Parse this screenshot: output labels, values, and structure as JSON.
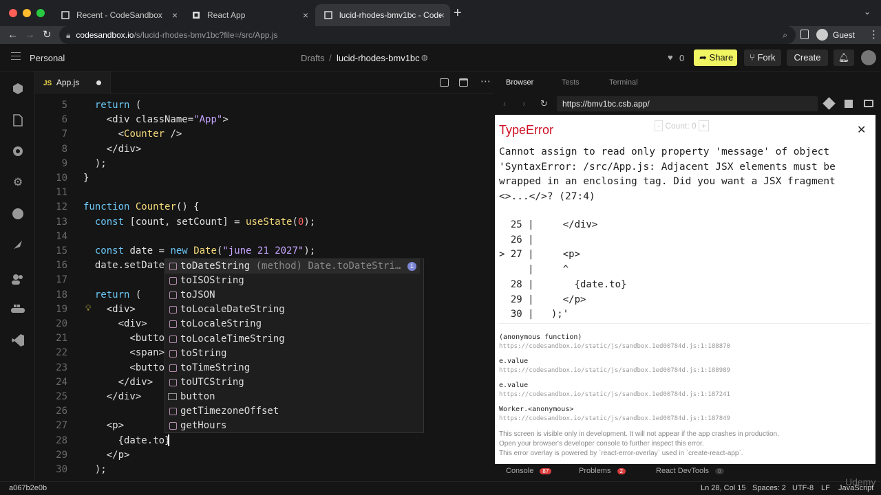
{
  "browser": {
    "tabs": [
      {
        "title": "Recent - CodeSandbox"
      },
      {
        "title": "React App"
      },
      {
        "title": "lucid-rhodes-bmv1bc - CodeS"
      }
    ],
    "url_host": "codesandbox.io",
    "url_path": "/s/lucid-rhodes-bmv1bc?file=/src/App.js",
    "profile": "Guest"
  },
  "header": {
    "workspace": "Personal",
    "breadcrumb_root": "Drafts",
    "breadcrumb_sep": "/",
    "sandbox": "lucid-rhodes-bmv1bc",
    "likes": "0",
    "share": "Share",
    "fork": "Fork",
    "create": "Create"
  },
  "editor": {
    "tab_label": "App.js",
    "tab_badge": "JS",
    "lines": [
      {
        "n": "5",
        "html": "  <span class='kw'>return</span> ("
      },
      {
        "n": "6",
        "html": "    &lt;div className=<span class='str'>\"App\"</span>&gt;"
      },
      {
        "n": "7",
        "html": "      &lt;<span class='cmp'>Counter</span> /&gt;"
      },
      {
        "n": "8",
        "html": "    &lt;/div&gt;"
      },
      {
        "n": "9",
        "html": "  );"
      },
      {
        "n": "10",
        "html": "}"
      },
      {
        "n": "11",
        "html": ""
      },
      {
        "n": "12",
        "html": "<span class='kw'>function</span> <span class='cmp'>Counter</span>() {"
      },
      {
        "n": "13",
        "html": "  <span class='kw'>const</span> [count, setCount] = <span class='cmp'>useState</span>(<span class='num'>0</span>);"
      },
      {
        "n": "14",
        "html": ""
      },
      {
        "n": "15",
        "html": "  <span class='kw'>const</span> date = <span class='kw'>new</span> <span class='cmp'>Date</span>(<span class='str'>\"june 21 2027\"</span>);"
      },
      {
        "n": "16",
        "html": "  date.setDate"
      },
      {
        "n": "17",
        "html": ""
      },
      {
        "n": "18",
        "html": "  <span class='kw'>return</span> ("
      },
      {
        "n": "19",
        "html": "    &lt;div&gt;"
      },
      {
        "n": "20",
        "html": "      &lt;div&gt;"
      },
      {
        "n": "21",
        "html": "        &lt;butto                                  button&gt;"
      },
      {
        "n": "22",
        "html": "        &lt;span&gt;"
      },
      {
        "n": "23",
        "html": "        &lt;butto                                  button&gt;"
      },
      {
        "n": "24",
        "html": "      &lt;/div&gt;"
      },
      {
        "n": "25",
        "html": "    &lt;/div&gt;"
      },
      {
        "n": "26",
        "html": ""
      },
      {
        "n": "27",
        "html": "    &lt;p&gt;"
      },
      {
        "n": "28",
        "html": "      {date.to}"
      },
      {
        "n": "29",
        "html": "    &lt;/p&gt;"
      },
      {
        "n": "30",
        "html": "  );"
      }
    ],
    "suggestions": [
      {
        "label": "toDateString",
        "detail": "(method) Date.toDateStri…",
        "kind": "method"
      },
      {
        "label": "toISOString",
        "kind": "method"
      },
      {
        "label": "toJSON",
        "kind": "method"
      },
      {
        "label": "toLocaleDateString",
        "kind": "method"
      },
      {
        "label": "toLocaleString",
        "kind": "method"
      },
      {
        "label": "toLocaleTimeString",
        "kind": "method"
      },
      {
        "label": "toString",
        "kind": "method"
      },
      {
        "label": "toTimeString",
        "kind": "method"
      },
      {
        "label": "toUTCString",
        "kind": "method"
      },
      {
        "label": "button",
        "kind": "word"
      },
      {
        "label": "getTimezoneOffset",
        "kind": "method"
      },
      {
        "label": "getHours",
        "kind": "method"
      }
    ]
  },
  "preview": {
    "tabs": [
      "Browser",
      "Tests",
      "Terminal"
    ],
    "url": "https://bmv1bc.csb.app/",
    "counter_text": "Count: 0",
    "error_title": "TypeError",
    "error_message": "Cannot assign to read only property 'message' of object 'SyntaxError: /src/App.js: Adjacent JSX elements must be wrapped in an enclosing tag. Did you want a JSX fragment <>...</>? (27:4)",
    "code_frame": [
      "  25 |     </div>",
      "  26 |",
      "> 27 |     <p>",
      "     |     ^",
      "  28 |       {date.to}",
      "  29 |     </p>",
      "  30 |   );'"
    ],
    "stack": [
      {
        "fn": "(anonymous function)",
        "url": "https://codesandbox.io/static/js/sandbox.1ed00784d.js:1:188870"
      },
      {
        "fn": "e.value",
        "url": "https://codesandbox.io/static/js/sandbox.1ed00784d.js:1:188989"
      },
      {
        "fn": "e.value",
        "url": "https://codesandbox.io/static/js/sandbox.1ed00784d.js:1:187241"
      },
      {
        "fn": "Worker.<anonymous>",
        "url": "https://codesandbox.io/static/js/sandbox.1ed00784d.js:1:187849"
      }
    ],
    "footer": [
      "This screen is visible only in development. It will not appear if the app crashes in production.",
      "Open your browser's developer console to further inspect this error.",
      "This error overlay is powered by `react-error-overlay` used in `create-react-app`."
    ],
    "bottom_tabs": [
      {
        "label": "Console",
        "badge": "87"
      },
      {
        "label": "Problems",
        "badge": "2"
      },
      {
        "label": "React DevTools",
        "badge": "0"
      }
    ]
  },
  "status": {
    "commit": "a067b2e0b",
    "position": "Ln 28, Col 15",
    "spaces": "Spaces: 2",
    "encoding": "UTF-8",
    "eol": "LF",
    "language": "JavaScript",
    "watermark": "Udemy"
  },
  "colors": {
    "accent_yellow": "#f0f562",
    "error_red": "#ce1126"
  }
}
